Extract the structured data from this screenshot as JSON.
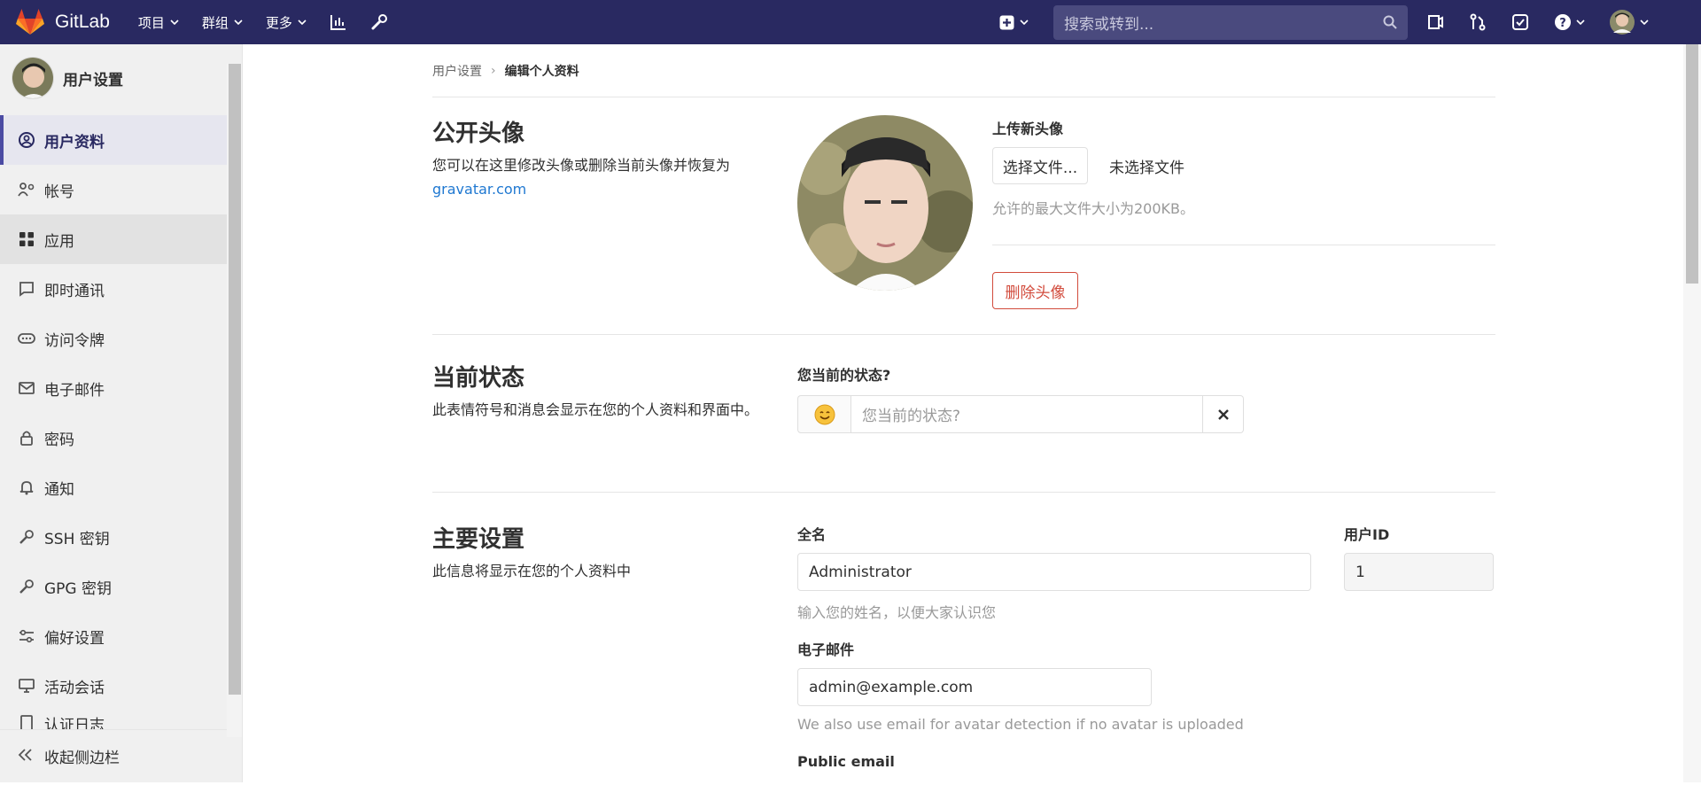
{
  "navbar": {
    "brand": "GitLab",
    "menu": [
      "项目",
      "群组",
      "更多"
    ],
    "search_placeholder": "搜索或转到..."
  },
  "sidebar": {
    "title": "用户设置",
    "items": [
      {
        "label": "用户资料",
        "icon": "user-circle-icon"
      },
      {
        "label": "帐号",
        "icon": "account-icon"
      },
      {
        "label": "应用",
        "icon": "applications-icon"
      },
      {
        "label": "即时通讯",
        "icon": "chat-icon"
      },
      {
        "label": "访问令牌",
        "icon": "token-icon"
      },
      {
        "label": "电子邮件",
        "icon": "mail-icon"
      },
      {
        "label": "密码",
        "icon": "lock-icon"
      },
      {
        "label": "通知",
        "icon": "bell-icon"
      },
      {
        "label": "SSH 密钥",
        "icon": "key-icon"
      },
      {
        "label": "GPG 密钥",
        "icon": "key-icon"
      },
      {
        "label": "偏好设置",
        "icon": "preferences-icon"
      },
      {
        "label": "活动会话",
        "icon": "monitor-icon"
      },
      {
        "label": "认证日志",
        "icon": "log-icon"
      }
    ],
    "collapse_label": "收起侧边栏"
  },
  "breadcrumb": {
    "parent": "用户设置",
    "current": "编辑个人资料"
  },
  "avatar_section": {
    "title": "公开头像",
    "desc": "您可以在这里修改头像或删除当前头像并恢复为",
    "desc_link": "gravatar.com",
    "upload_label": "上传新头像",
    "choose_file": "选择文件...",
    "no_file": "未选择文件",
    "size_hint": "允许的最大文件大小为200KB。",
    "remove_button": "删除头像"
  },
  "status_section": {
    "title": "当前状态",
    "desc": "此表情符号和消息会显示在您的个人资料和界面中。",
    "field_label": "您当前的状态?",
    "placeholder": "您当前的状态?"
  },
  "main_section": {
    "title": "主要设置",
    "desc": "此信息将显示在您的个人资料中",
    "fullname_label": "全名",
    "fullname_value": "Administrator",
    "fullname_hint": "输入您的姓名，以便大家认识您",
    "userid_label": "用户ID",
    "userid_value": "1",
    "email_label": "电子邮件",
    "email_value": "admin@example.com",
    "email_hint": "We also use email for avatar detection if no avatar is uploaded",
    "public_email_label": "Public email"
  },
  "colors": {
    "navbar": "#292961",
    "link": "#1f78d1",
    "danger": "#d24b3c"
  }
}
